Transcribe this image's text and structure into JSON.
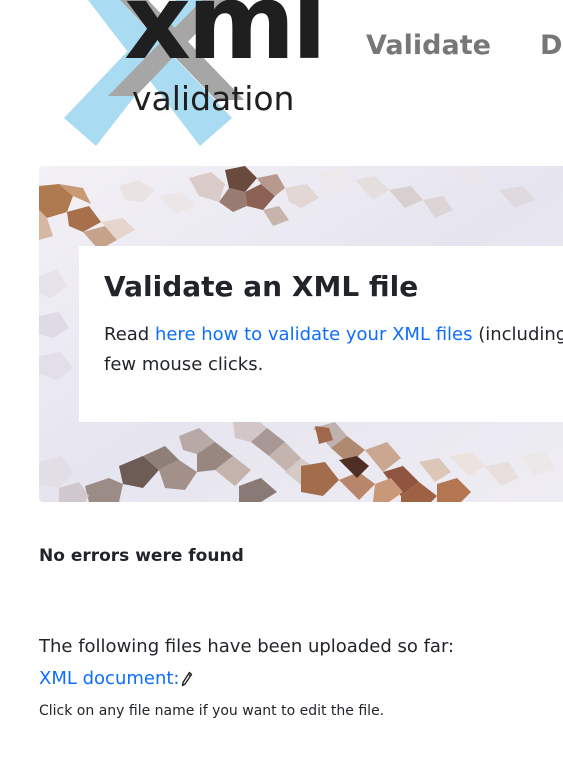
{
  "header": {
    "logo": {
      "wordmark": "xml",
      "subtitle": "validation"
    },
    "nav": [
      {
        "label": "Validate"
      },
      {
        "label": "Do"
      }
    ]
  },
  "hero": {
    "title": "Validate an XML file",
    "text_before": "Read ",
    "link_text": "here how to validate your XML files",
    "text_after": " (including\nfew mouse clicks."
  },
  "result": {
    "status": "No errors were found",
    "uploaded_intro": "The following files have been uploaded so far:",
    "file_link": "XML document:",
    "hint": "Click on any file name if you want to edit the file."
  },
  "colors": {
    "link": "#0d6efd",
    "nav": "#777777",
    "logo_cross_light": "#a9dcf2",
    "logo_cross_gray": "#a6a6a6"
  },
  "icons": {
    "edit": "pencil-icon"
  }
}
